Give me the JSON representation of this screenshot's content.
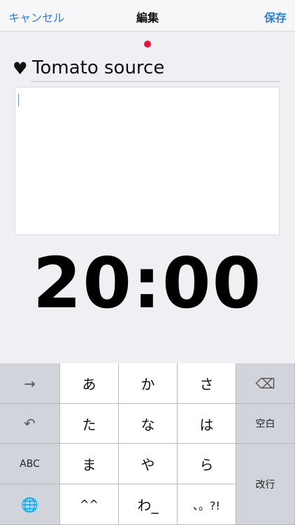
{
  "navbar": {
    "cancel_label": "キャンセル",
    "title": "編集",
    "save_label": "保存"
  },
  "editor": {
    "icon": "heart-icon",
    "heart_glyph": "♥",
    "name_value": "Tomato source",
    "memo_value": "",
    "timer_display": "20:00"
  },
  "keyboard": {
    "next_icon": "arrow-right-icon",
    "next_glyph": "→",
    "undo_icon": "undo-icon",
    "undo_glyph": "↶",
    "abc_label": "ABC",
    "globe_icon": "globe-icon",
    "globe_glyph": "🌐",
    "delete_icon": "delete-icon",
    "delete_glyph": "⌫",
    "space_label": "空白",
    "return_label": "改行",
    "kana": [
      "あ",
      "か",
      "さ",
      "た",
      "な",
      "は",
      "ま",
      "や",
      "ら",
      "^^",
      "わ_",
      "、。?!"
    ]
  }
}
